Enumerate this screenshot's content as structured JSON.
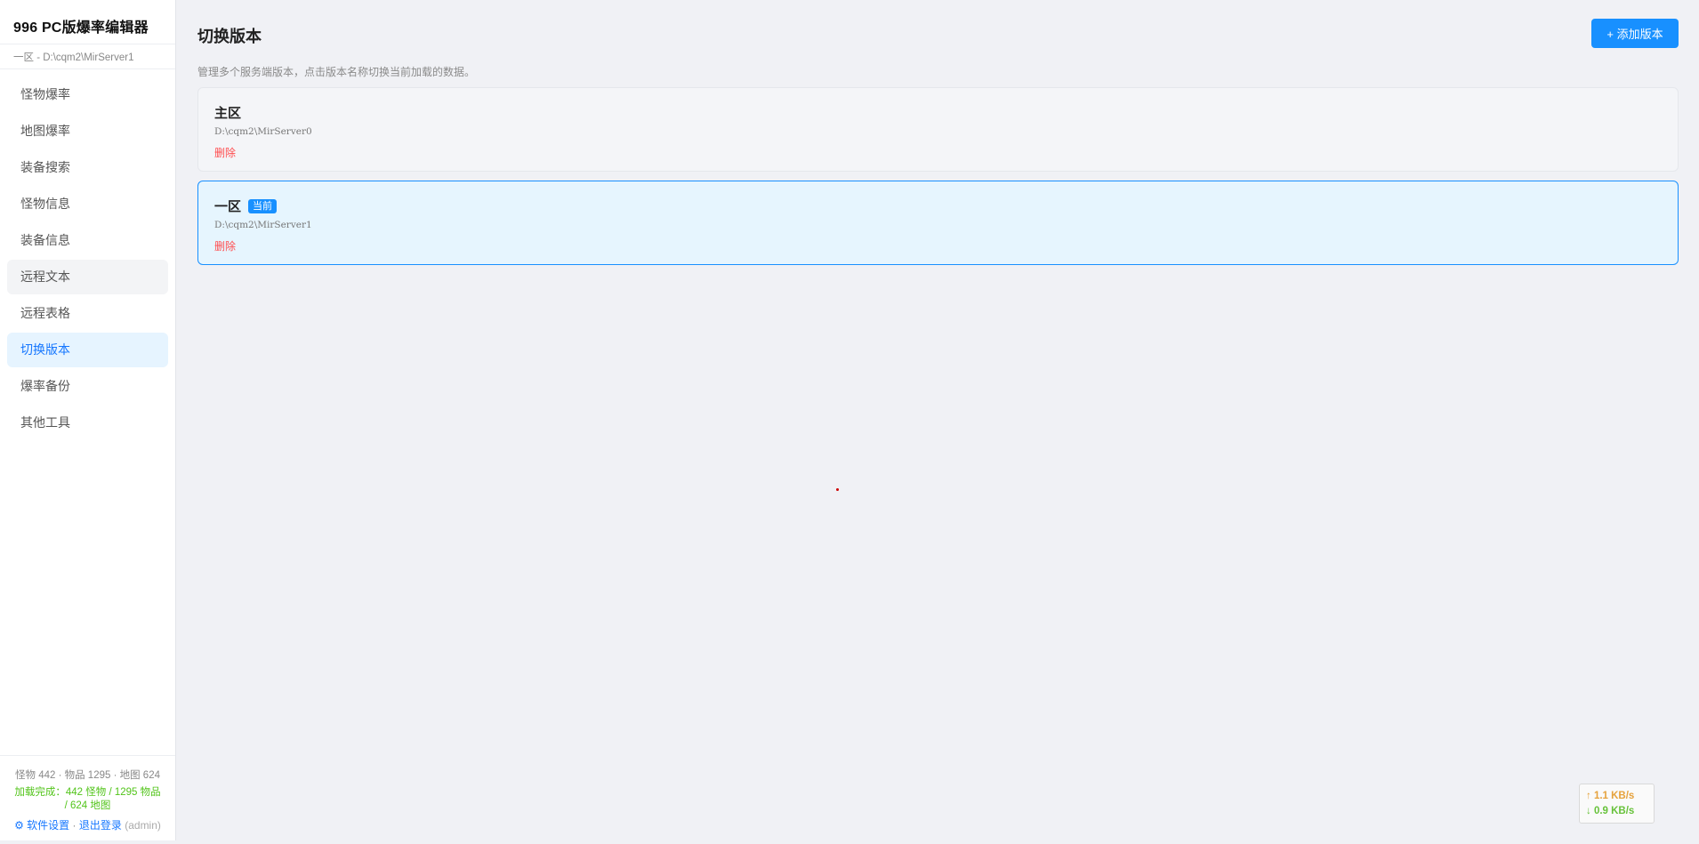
{
  "app": {
    "title": "996 PC版爆率编辑器",
    "subtitle": "一区 - D:\\cqm2\\MirServer1"
  },
  "sidebar": {
    "items": [
      {
        "label": "怪物爆率"
      },
      {
        "label": "地图爆率"
      },
      {
        "label": "装备搜索"
      },
      {
        "label": "怪物信息"
      },
      {
        "label": "装备信息"
      },
      {
        "label": "远程文本"
      },
      {
        "label": "远程表格"
      },
      {
        "label": "切换版本"
      },
      {
        "label": "爆率备份"
      },
      {
        "label": "其他工具"
      }
    ],
    "active_index": 7,
    "hover_index": 5,
    "footer": {
      "stats": "怪物 442 · 物品 1295 · 地图 624",
      "load_status": "加载完成：442 怪物 / 1295 物品 / 624 地图",
      "settings_link": "⚙ 软件设置",
      "separator": " · ",
      "logout_link": "退出登录",
      "user": "(admin)"
    }
  },
  "main": {
    "title": "切换版本",
    "add_button": "+ 添加版本",
    "description": "管理多个服务端版本，点击版本名称切换当前加载的数据。",
    "versions": [
      {
        "name": "主区",
        "path": "D:\\cqm2\\MirServer0",
        "delete_label": "删除",
        "current": false
      },
      {
        "name": "一区",
        "path": "D:\\cqm2\\MirServer1",
        "delete_label": "删除",
        "current": true,
        "current_badge": "当前"
      }
    ]
  },
  "network": {
    "upload": "↑ 1.1 KB/s",
    "download": "↓ 0.9 KB/s"
  },
  "colors": {
    "primary": "#1890ff",
    "danger": "#ff4d4f",
    "success": "#52c41a",
    "active_bg": "#e6f4ff"
  }
}
